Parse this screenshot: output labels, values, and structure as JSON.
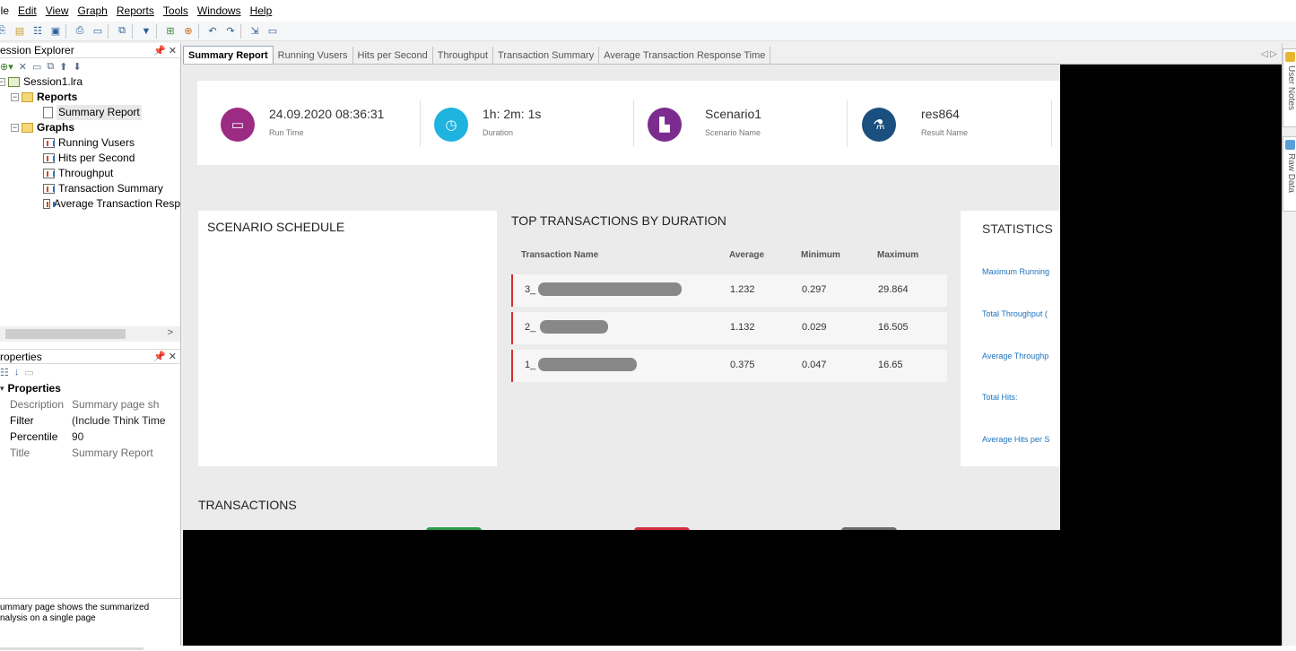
{
  "menu": [
    "ile",
    "Edit",
    "View",
    "Graph",
    "Reports",
    "Tools",
    "Windows",
    "Help"
  ],
  "session_explorer": {
    "title": "ession Explorer",
    "tree": {
      "session": "Session1.lra",
      "reports_label": "Reports",
      "summary_report": "Summary Report",
      "graphs_label": "Graphs",
      "graphs": [
        "Running Vusers",
        "Hits per Second",
        "Throughput",
        "Transaction Summary",
        "Average Transaction Resp"
      ]
    }
  },
  "properties_pane": {
    "title": "roperties",
    "group": "Properties",
    "rows": [
      {
        "key": "Description",
        "value": "Summary page sh",
        "dim": true
      },
      {
        "key": "Filter",
        "value": "(Include Think Time",
        "dim": false
      },
      {
        "key": "Percentile",
        "value": "90",
        "dim": false
      },
      {
        "key": "Title",
        "value": "Summary Report",
        "dim": true
      }
    ],
    "description_line1": "ummary page shows the summarized",
    "description_line2": "nalysis on a single page"
  },
  "tabs": [
    "Summary Report",
    "Running Vusers",
    "Hits per Second",
    "Throughput",
    "Transaction Summary",
    "Average Transaction Response Time"
  ],
  "kpis": [
    {
      "value": "24.09.2020 08:36:31",
      "label": "Run Time",
      "color": "#9c2b84",
      "icon": "calendar-icon"
    },
    {
      "value": "1h: 2m: 1s",
      "label": "Duration",
      "color": "#1fb3e0",
      "icon": "clock-icon"
    },
    {
      "value": "Scenario1",
      "label": "Scenario Name",
      "color": "#7b2c8e",
      "icon": "document-icon"
    },
    {
      "value": "res864",
      "label": "Result Name",
      "color": "#1b4f7f",
      "icon": "flask-icon"
    }
  ],
  "scenario_schedule": {
    "title": "SCENARIO SCHEDULE"
  },
  "top_transactions": {
    "title": "TOP TRANSACTIONS BY DURATION",
    "headers": {
      "name": "Transaction Name",
      "avg": "Average",
      "min": "Minimum",
      "max": "Maximum"
    },
    "rows": [
      {
        "name": "3_",
        "avg": "1.232",
        "min": "0.297",
        "max": "29.864"
      },
      {
        "name": "2_",
        "avg": "1.132",
        "min": "0.029",
        "max": "16.505"
      },
      {
        "name": "1_",
        "avg": "0.375",
        "min": "0.047",
        "max": "16.65"
      }
    ]
  },
  "statistics": {
    "title": "STATISTICS",
    "items": [
      "Maximum Running",
      "Total Throughput (",
      "Average Throughp",
      "Total Hits:",
      "Average Hits per S"
    ]
  },
  "transactions": {
    "title": "TRANSACTIONS"
  },
  "right_dock": {
    "user_notes": "User Notes",
    "raw_data": "Raw Data"
  }
}
